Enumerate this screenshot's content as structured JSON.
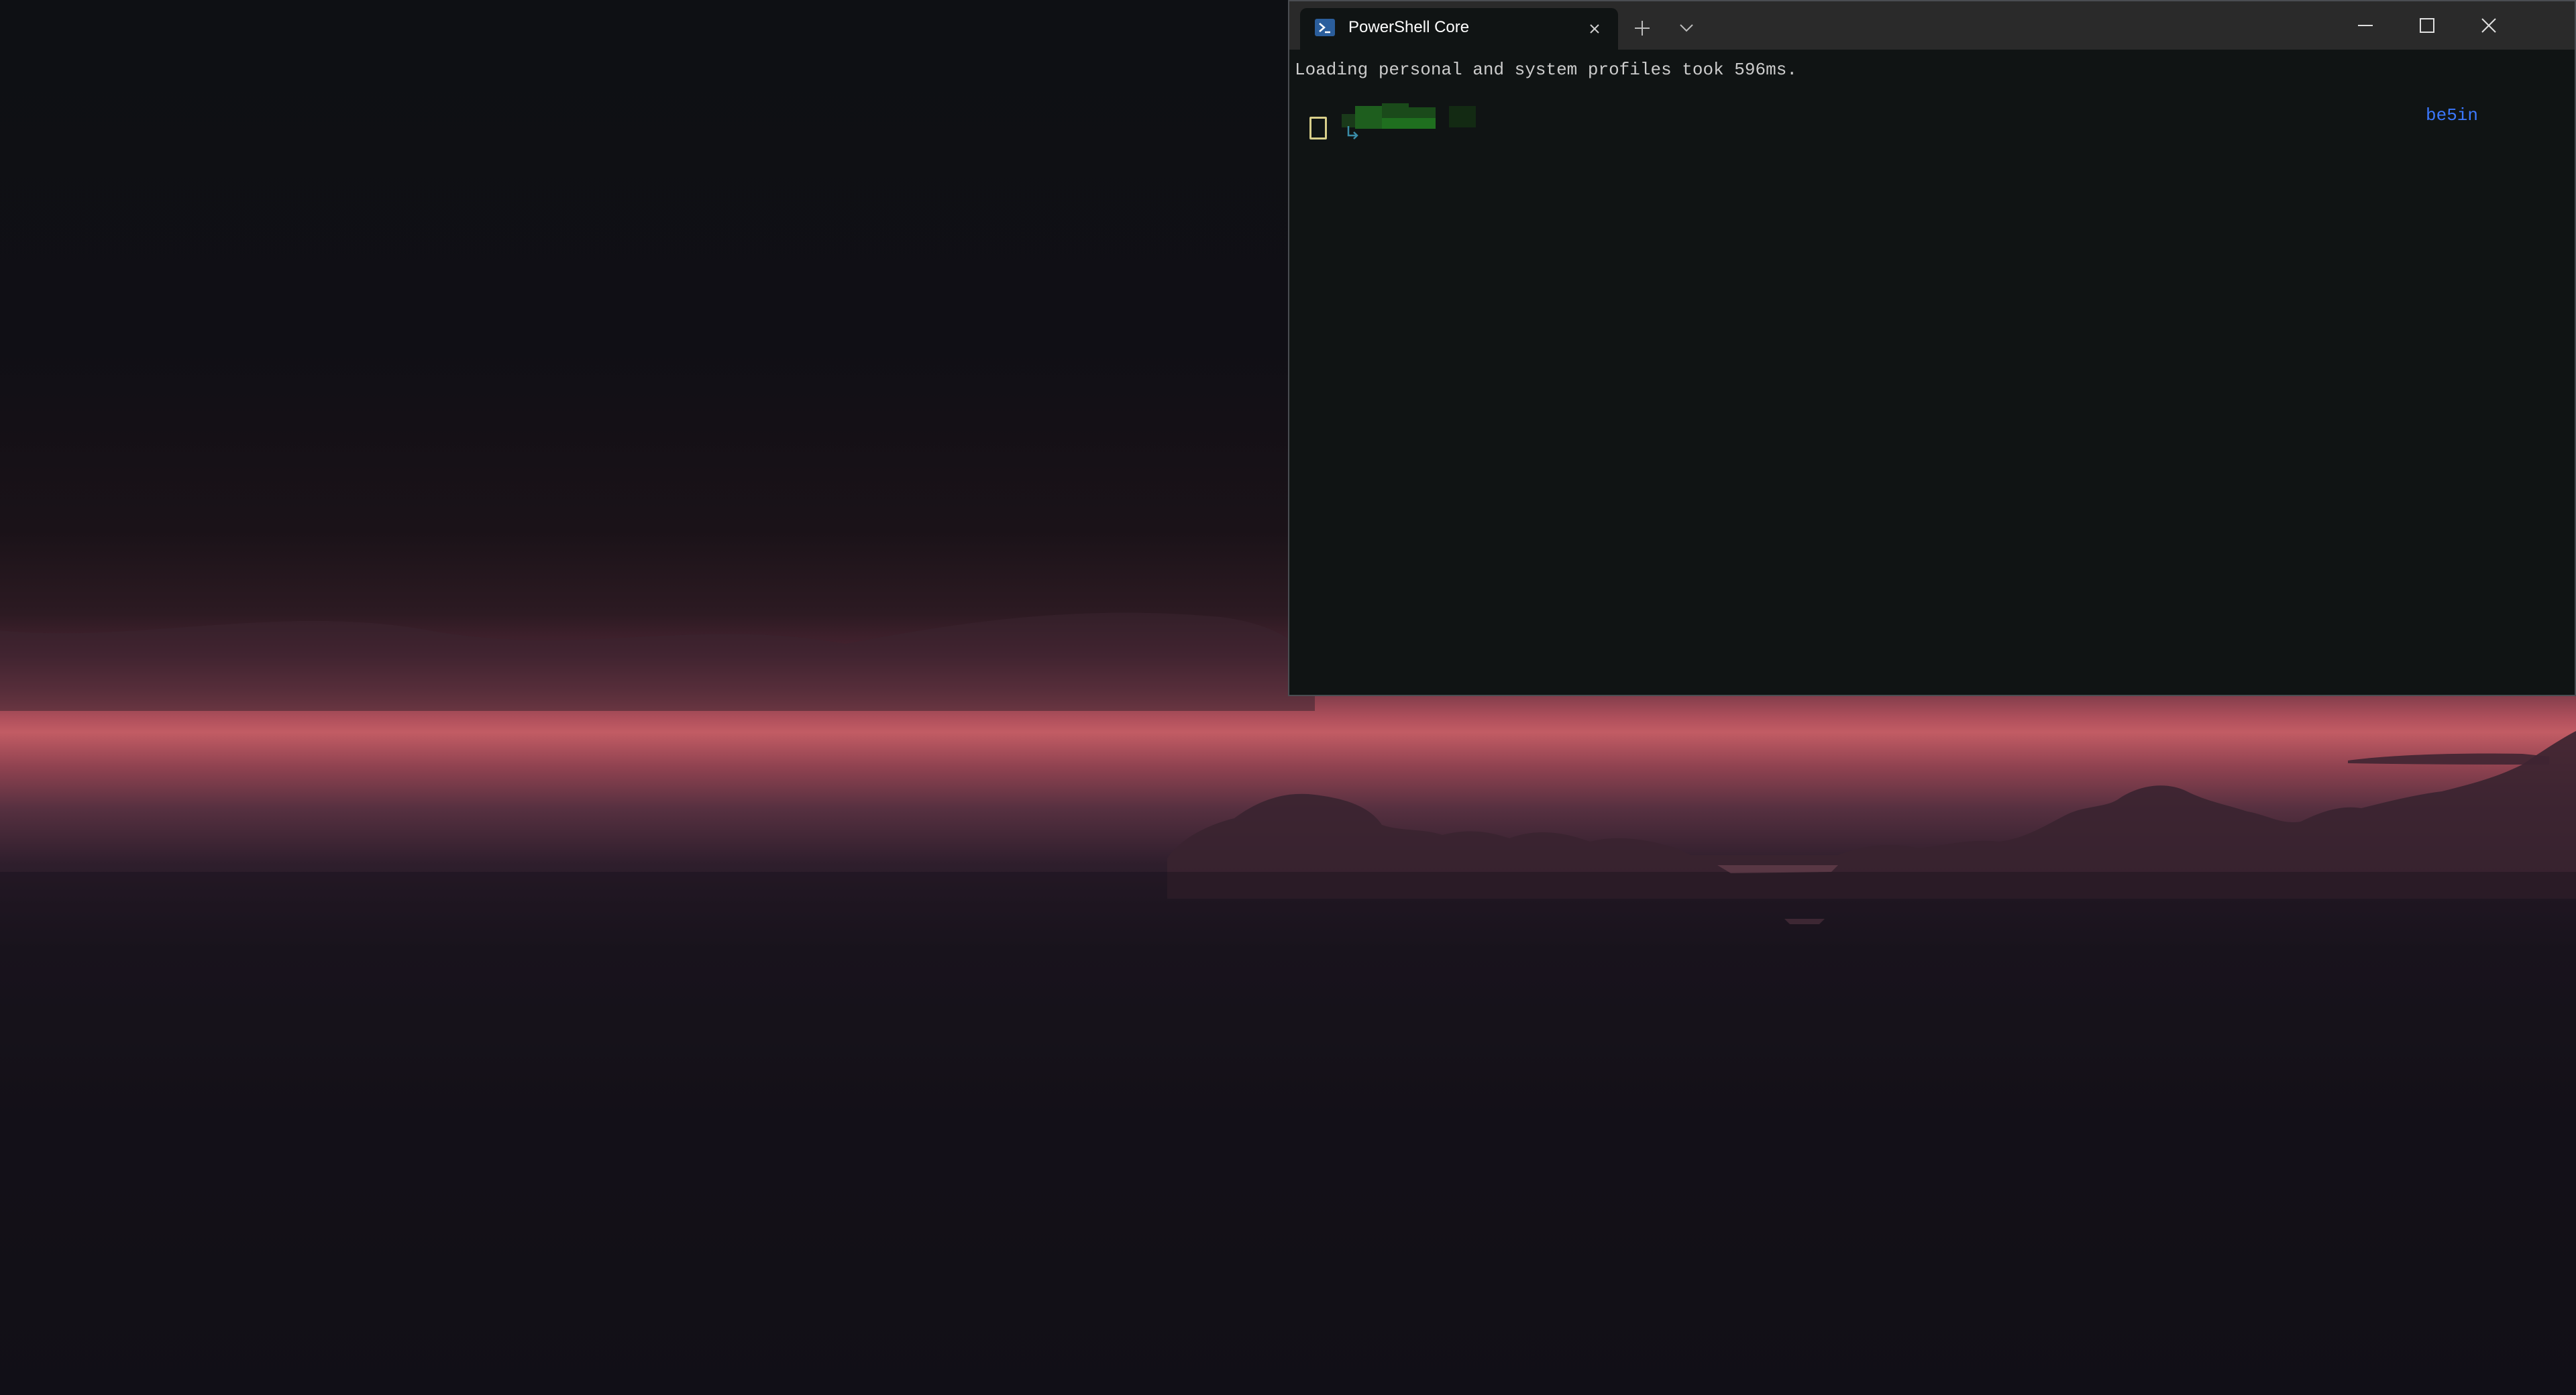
{
  "window": {
    "tab_title": "PowerShell Core",
    "tab_icon": "powershell-icon",
    "controls": {
      "new_tab_icon": "plus-icon",
      "dropdown_icon": "chevron-down-icon",
      "minimize_icon": "minimize-icon",
      "maximize_icon": "maximize-icon",
      "close_icon": "close-icon"
    }
  },
  "terminal": {
    "output_line": "Loading personal and system profiles took 596ms.",
    "prompt_right": "be5in",
    "colors": {
      "background": "#101414",
      "text": "#cccccc",
      "right_prompt": "#3b78ff",
      "prompt_path": "#1e6e1e",
      "prompt_glyph": "#d8cf8a"
    }
  }
}
